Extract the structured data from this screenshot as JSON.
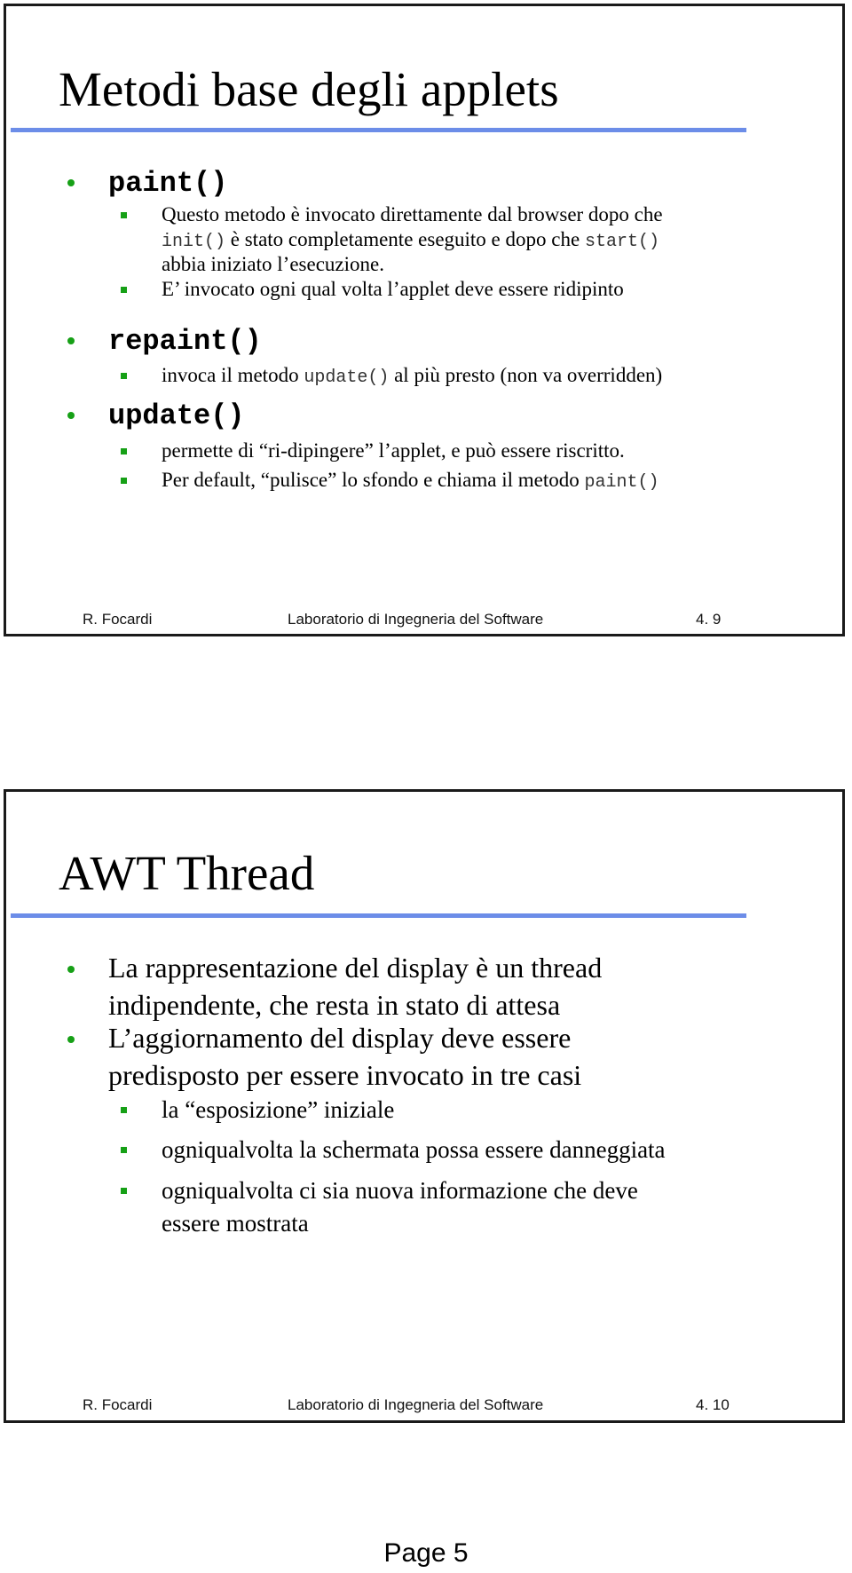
{
  "slides": [
    {
      "title": "Metodi base degli applets",
      "items": [
        {
          "heading": "paint()",
          "subitems": [
            {
              "lines": [
                [
                  {
                    "t": "Questo metodo è invocato direttamente dal browser dopo che"
                  }
                ],
                [
                  {
                    "t": "init()",
                    "code": true
                  },
                  {
                    "t": " è stato completamente eseguito e dopo che "
                  },
                  {
                    "t": "start()",
                    "code": true
                  }
                ],
                [
                  {
                    "t": "abbia iniziato l’esecuzione."
                  }
                ]
              ]
            },
            {
              "lines": [
                [
                  {
                    "t": "E’ invocato ogni qual volta l’applet deve essere ridipinto"
                  }
                ]
              ]
            }
          ]
        },
        {
          "heading": "repaint()",
          "subitems": [
            {
              "lines": [
                [
                  {
                    "t": "invoca il metodo "
                  },
                  {
                    "t": "update()",
                    "code": true
                  },
                  {
                    "t": " al più presto (non va overridden)"
                  }
                ]
              ]
            }
          ]
        },
        {
          "heading": "update()",
          "subitems": [
            {
              "lines": [
                [
                  {
                    "t": "permette di “ri-dipingere” l’applet, e può essere riscritto."
                  }
                ]
              ]
            },
            {
              "lines": [
                [
                  {
                    "t": "Per default, “pulisce” lo sfondo e chiama il metodo "
                  },
                  {
                    "t": "paint()",
                    "code": true
                  }
                ]
              ]
            }
          ]
        }
      ],
      "footer": {
        "author": "R. Focardi",
        "course": "Laboratorio di Ingegneria del Software",
        "number": "4. 9"
      }
    },
    {
      "title": "AWT Thread",
      "items": [
        {
          "lines": [
            "La rappresentazione del display è un thread",
            "indipendente, che resta in stato di attesa"
          ]
        },
        {
          "lines": [
            "L’aggiornamento del display deve essere",
            "predisposto per essere invocato in tre casi"
          ],
          "subitems": [
            {
              "lines": [
                "la “esposizione” iniziale"
              ]
            },
            {
              "lines": [
                "ogniqualvolta la schermata possa essere danneggiata"
              ]
            },
            {
              "lines": [
                "ogniqualvolta ci sia nuova informazione che deve",
                "essere mostrata"
              ]
            }
          ]
        }
      ],
      "footer": {
        "author": "R. Focardi",
        "course": "Laboratorio di Ingegneria del Software",
        "number": "4. 10"
      }
    }
  ],
  "page_label": "Page 5",
  "colors": {
    "accent_rule": "#6c8de8",
    "bullet": "#16a016"
  }
}
